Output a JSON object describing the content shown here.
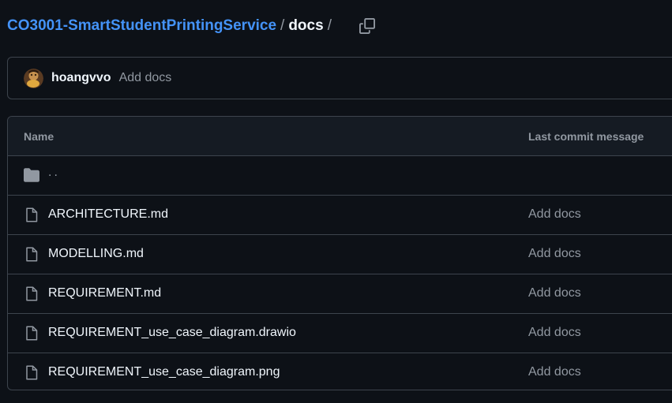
{
  "breadcrumb": {
    "repo": "CO3001-SmartStudentPrintingService",
    "separator": "/",
    "current": "docs",
    "trailing_separator": "/"
  },
  "latest_commit": {
    "author": "hoangvvo",
    "message": "Add docs"
  },
  "table": {
    "headers": {
      "name": "Name",
      "last_commit": "Last commit message"
    },
    "parent_link": "..",
    "files": [
      {
        "name": "ARCHITECTURE.md",
        "commit": "Add docs",
        "icon": "file-icon"
      },
      {
        "name": "MODELLING.md",
        "commit": "Add docs",
        "icon": "file-icon"
      },
      {
        "name": "REQUIREMENT.md",
        "commit": "Add docs",
        "icon": "file-icon"
      },
      {
        "name": "REQUIREMENT_use_case_diagram.drawio",
        "commit": "Add docs",
        "icon": "file-icon"
      },
      {
        "name": "REQUIREMENT_use_case_diagram.png",
        "commit": "Add docs",
        "icon": "file-icon"
      }
    ]
  },
  "colors": {
    "background": "#0d1117",
    "link": "#4493f8",
    "text": "#f0f6fc",
    "muted": "#9198a1",
    "border": "#3d444d",
    "header_bg": "#151b23"
  }
}
